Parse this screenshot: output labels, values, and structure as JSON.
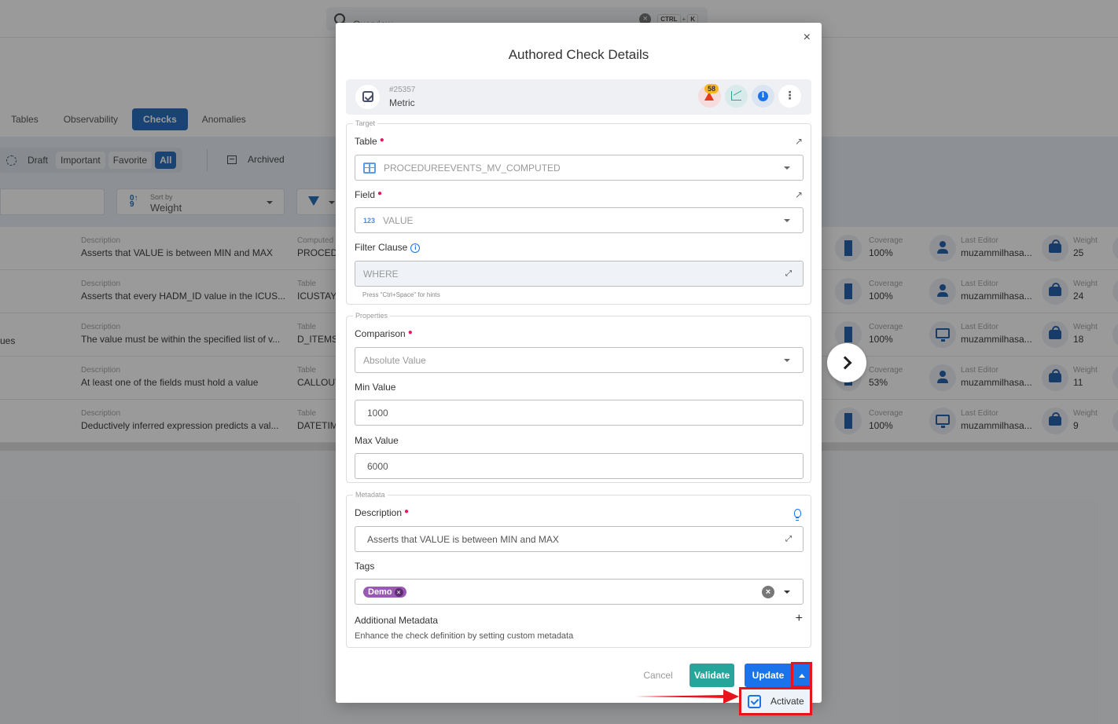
{
  "topbar": {
    "search_placeholder": "Overview",
    "shortcut_keys": [
      "CTRL",
      "K"
    ],
    "shortcut_plus": "+"
  },
  "nav_tabs": [
    {
      "label": "Tables",
      "active": false
    },
    {
      "label": "Observability",
      "active": false
    },
    {
      "label": "Checks",
      "active": true
    },
    {
      "label": "Anomalies",
      "active": false
    }
  ],
  "status_filters": {
    "draft": "Draft",
    "important": "Important",
    "favorite": "Favorite",
    "all": "All",
    "archived": "Archived"
  },
  "sort": {
    "label": "Sort by",
    "value": "Weight"
  },
  "checks_list": [
    {
      "left_text": "",
      "desc_label": "Description",
      "description": "Asserts that VALUE is between MIN and MAX",
      "table_label": "Computed",
      "table": "PROCEDU",
      "coverage_label": "Coverage",
      "coverage": "100%",
      "editor_label": "Last Editor",
      "editor": "muzammilhasa...",
      "editor_icon": "user-icon",
      "weight_label": "Weight",
      "weight": "25"
    },
    {
      "left_text": "",
      "desc_label": "Description",
      "description": "Asserts that every HADM_ID value in the ICUS...",
      "table_label": "Table",
      "table": "ICUSTAYS",
      "coverage_label": "Coverage",
      "coverage": "100%",
      "editor_label": "Last Editor",
      "editor": "muzammilhasa...",
      "editor_icon": "user-icon",
      "weight_label": "Weight",
      "weight": "24"
    },
    {
      "left_text": "ues",
      "desc_label": "Description",
      "description": "The value must be within the specified list of v...",
      "table_label": "Table",
      "table": "D_ITEMS",
      "coverage_label": "Coverage",
      "coverage": "100%",
      "editor_label": "Last Editor",
      "editor": "muzammilhasa...",
      "editor_icon": "monitor-icon",
      "weight_label": "Weight",
      "weight": "18"
    },
    {
      "left_text": "",
      "desc_label": "Description",
      "description": "At least one of the fields must hold a value",
      "table_label": "Table",
      "table": "CALLOUT",
      "coverage_label": "Coverage",
      "coverage": "53%",
      "editor_label": "Last Editor",
      "editor": "muzammilhasa...",
      "editor_icon": "user-icon",
      "weight_label": "Weight",
      "weight": "11"
    },
    {
      "left_text": "",
      "desc_label": "Description",
      "description": "Deductively inferred expression predicts a val...",
      "table_label": "Table",
      "table": "DATETIM",
      "coverage_label": "Coverage",
      "coverage": "100%",
      "editor_label": "Last Editor",
      "editor": "muzammilhasa...",
      "editor_icon": "monitor-icon",
      "weight_label": "Weight",
      "weight": "9"
    }
  ],
  "modal": {
    "title": "Authored Check Details",
    "close": "×",
    "check_id": "#25357",
    "check_type": "Metric",
    "anomaly_count": "58",
    "more": "⋮",
    "target": {
      "legend": "Target",
      "table_label": "Table",
      "table_value": "PROCEDUREEVENTS_MV_COMPUTED",
      "field_label": "Field",
      "field_type": "123",
      "field_value": "VALUE",
      "filter_label": "Filter Clause",
      "filter_placeholder": "WHERE",
      "filter_hint": "Press \"Ctrl+Space\" for hints"
    },
    "properties": {
      "legend": "Properties",
      "comparison_label": "Comparison",
      "comparison_placeholder": "Absolute Value",
      "min_label": "Min Value",
      "min_value": "1000",
      "max_label": "Max Value",
      "max_value": "6000"
    },
    "metadata": {
      "legend": "Metadata",
      "description_label": "Description",
      "description_value": "Asserts that VALUE is between MIN and MAX",
      "tags_label": "Tags",
      "tags": [
        "Demo"
      ],
      "additional_label": "Additional Metadata",
      "additional_desc": "Enhance the check definition by setting custom metadata"
    },
    "buttons": {
      "cancel": "Cancel",
      "validate": "Validate",
      "update": "Update"
    },
    "dropdown_menu": {
      "activate": "Activate"
    }
  },
  "colors": {
    "primary": "#1a73e8",
    "nav_active": "#0a5bb5",
    "validate": "#26a69a",
    "tag": "#9b59b6",
    "required": "#e5195e",
    "highlight": "#e8141b",
    "anomaly_badge": "#f7b71e"
  }
}
